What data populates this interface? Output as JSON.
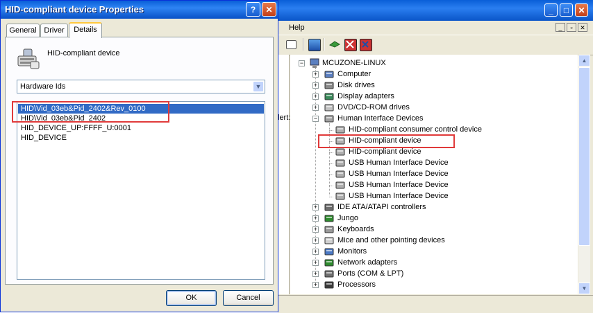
{
  "device_manager": {
    "menu": {
      "help": "Help"
    },
    "left_pane_fragment": "lert:",
    "tree": {
      "root": "MCUZONE-LINUX",
      "nodes": [
        {
          "label": "Computer",
          "icon": "computer-icon",
          "expanded": false
        },
        {
          "label": "Disk drives",
          "icon": "disk-drive-icon",
          "expanded": false
        },
        {
          "label": "Display adapters",
          "icon": "display-adapter-icon",
          "expanded": false
        },
        {
          "label": "DVD/CD-ROM drives",
          "icon": "cdrom-icon",
          "expanded": false
        },
        {
          "label": "Human Interface Devices",
          "icon": "hid-icon",
          "expanded": true
        },
        {
          "label": "HID-compliant consumer control device",
          "icon": "hid-device-icon",
          "child": true
        },
        {
          "label": "HID-compliant device",
          "icon": "hid-device-icon",
          "child": true,
          "highlighted": true
        },
        {
          "label": "HID-compliant device",
          "icon": "hid-device-icon",
          "child": true
        },
        {
          "label": "USB Human Interface Device",
          "icon": "hid-device-icon",
          "child": true
        },
        {
          "label": "USB Human Interface Device",
          "icon": "hid-device-icon",
          "child": true
        },
        {
          "label": "USB Human Interface Device",
          "icon": "hid-device-icon",
          "child": true
        },
        {
          "label": "USB Human Interface Device",
          "icon": "hid-device-icon",
          "child": true
        },
        {
          "label": "IDE ATA/ATAPI controllers",
          "icon": "ide-controller-icon",
          "expanded": false
        },
        {
          "label": "Jungo",
          "icon": "jungo-icon",
          "expanded": false
        },
        {
          "label": "Keyboards",
          "icon": "keyboard-icon",
          "expanded": false
        },
        {
          "label": "Mice and other pointing devices",
          "icon": "mouse-icon",
          "expanded": false
        },
        {
          "label": "Monitors",
          "icon": "monitor-icon",
          "expanded": false
        },
        {
          "label": "Network adapters",
          "icon": "network-adapter-icon",
          "expanded": false
        },
        {
          "label": "Ports (COM & LPT)",
          "icon": "port-icon",
          "expanded": false
        },
        {
          "label": "Processors",
          "icon": "processor-icon",
          "expanded": false
        }
      ]
    }
  },
  "dialog": {
    "title": "HID-compliant device Properties",
    "tabs": [
      "General",
      "Driver",
      "Details"
    ],
    "active_tab": "Details",
    "device_name": "HID-compliant device",
    "property_select": "Hardware Ids",
    "values": [
      "HID\\Vid_03eb&Pid_2402&Rev_0100",
      "HID\\Vid_03eb&Pid_2402",
      "HID_DEVICE_UP:FFFF_U:0001",
      "HID_DEVICE"
    ],
    "ok_label": "OK",
    "cancel_label": "Cancel"
  },
  "colors": {
    "titlebar_blue": "#0a5fd8",
    "selection": "#316ac5",
    "highlight_box": "#e03a3a",
    "window_face": "#ece9d8"
  }
}
